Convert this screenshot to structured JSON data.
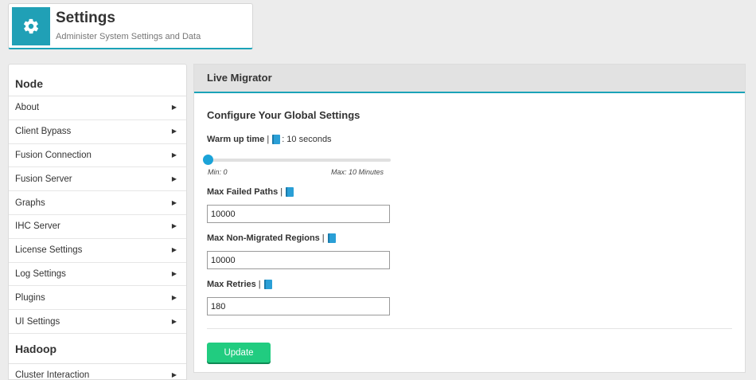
{
  "header": {
    "title": "Settings",
    "subtitle": "Administer System Settings and Data",
    "icon": "gear-icon"
  },
  "sidebar": {
    "sections": [
      {
        "title": "Node",
        "items": [
          {
            "label": "About"
          },
          {
            "label": "Client Bypass"
          },
          {
            "label": "Fusion Connection"
          },
          {
            "label": "Fusion Server"
          },
          {
            "label": "Graphs"
          },
          {
            "label": "IHC Server"
          },
          {
            "label": "License Settings"
          },
          {
            "label": "Log Settings"
          },
          {
            "label": "Plugins"
          },
          {
            "label": "UI Settings"
          }
        ]
      },
      {
        "title": "Hadoop",
        "items": [
          {
            "label": "Cluster Interaction"
          }
        ]
      }
    ],
    "arrow": "▶"
  },
  "panel": {
    "title": "Live Migrator",
    "section_title": "Configure Your Global Settings",
    "warmup": {
      "label": "Warm up time",
      "separator": "|",
      "value_text": ": 10 seconds",
      "slider_value": 0,
      "min_label": "Min: 0",
      "max_label": "Max: 10 Minutes"
    },
    "max_failed_paths": {
      "label": "Max Failed Paths",
      "separator": "|",
      "value": "10000"
    },
    "max_non_migrated": {
      "label": "Max Non-Migrated Regions",
      "separator": "|",
      "value": "10000"
    },
    "max_retries": {
      "label": "Max Retries",
      "separator": "|",
      "value": "180"
    },
    "update_label": "Update"
  },
  "colors": {
    "accent": "#1ba3b8",
    "button": "#21cc80",
    "help_icon": "#2a9fd6"
  }
}
